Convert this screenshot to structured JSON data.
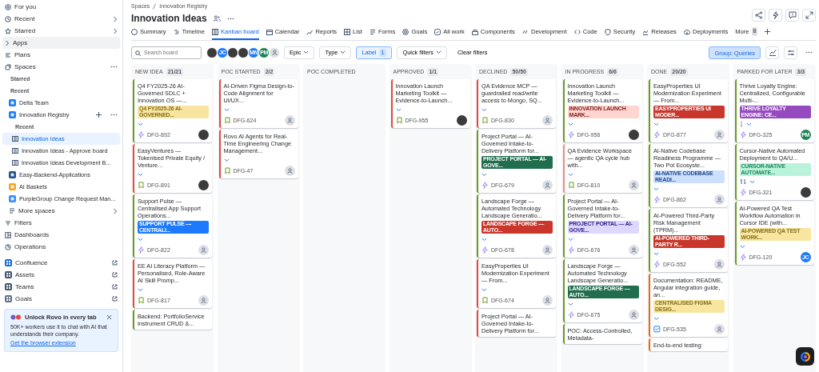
{
  "sidebar": {
    "items": [
      {
        "kind": "nav",
        "label": "For you",
        "submenu": false,
        "menu": false,
        "add": false,
        "external": false,
        "selected": false
      },
      {
        "kind": "nav",
        "label": "Recent",
        "submenu": true,
        "menu": false,
        "add": false,
        "external": false,
        "selected": false
      },
      {
        "kind": "nav",
        "label": "Starred",
        "submenu": true,
        "menu": false,
        "add": false,
        "external": false,
        "selected": false
      },
      {
        "kind": "expander",
        "label": "Apps",
        "submenu": false,
        "menu": false,
        "add": false,
        "external": false,
        "selected": false
      },
      {
        "kind": "nav",
        "label": "Plans",
        "submenu": false,
        "menu": false,
        "add": false,
        "external": false,
        "selected": false
      },
      {
        "kind": "nav",
        "label": "Spaces",
        "submenu": false,
        "menu": true,
        "add": false,
        "external": false,
        "selected": false
      },
      {
        "kind": "heading",
        "label": "Starred",
        "submenu": false,
        "menu": false,
        "add": false,
        "external": false,
        "selected": false
      },
      {
        "kind": "heading",
        "label": "Recent",
        "submenu": false,
        "menu": false,
        "add": false,
        "external": false,
        "selected": false
      },
      {
        "kind": "space",
        "label": "Delta Team",
        "color": "#1d7afc",
        "submenu": false,
        "menu": false,
        "add": false,
        "external": false,
        "selected": false
      },
      {
        "kind": "space",
        "label": "Innovation Registry",
        "color": "#1d7afc",
        "submenu": false,
        "menu": true,
        "add": true,
        "external": false,
        "selected": false
      },
      {
        "kind": "subheading",
        "label": "Recent",
        "submenu": false,
        "menu": false,
        "add": false,
        "external": false,
        "selected": false
      },
      {
        "kind": "board",
        "label": "Innovation Ideas",
        "submenu": false,
        "menu": false,
        "add": false,
        "external": false,
        "selected": true
      },
      {
        "kind": "board",
        "label": "Innovation Ideas - Approve board",
        "submenu": false,
        "menu": false,
        "add": false,
        "external": false,
        "selected": false
      },
      {
        "kind": "board",
        "label": "Innovation Ideas Development B...",
        "submenu": false,
        "menu": false,
        "add": false,
        "external": false,
        "selected": false
      },
      {
        "kind": "space",
        "label": "Easy-Backend-Applications",
        "color": "#1f4f8f",
        "submenu": false,
        "menu": false,
        "add": false,
        "external": false,
        "selected": false
      },
      {
        "kind": "space",
        "label": "AI Baskets",
        "color": "#f5a623",
        "submenu": false,
        "menu": false,
        "add": false,
        "external": false,
        "selected": false
      },
      {
        "kind": "space",
        "label": "PurpleGroup Change Request Man...",
        "color": "#388bff",
        "submenu": false,
        "menu": false,
        "add": false,
        "external": false,
        "selected": false
      },
      {
        "kind": "more",
        "label": "More spaces",
        "submenu": true,
        "menu": false,
        "add": false,
        "external": false,
        "selected": false
      },
      {
        "kind": "nav",
        "label": "Filters",
        "submenu": false,
        "menu": false,
        "add": false,
        "external": false,
        "selected": false
      },
      {
        "kind": "nav",
        "label": "Dashboards",
        "submenu": false,
        "menu": false,
        "add": false,
        "external": false,
        "selected": false
      },
      {
        "kind": "nav",
        "label": "Operations",
        "submenu": false,
        "menu": false,
        "add": false,
        "external": false,
        "selected": false
      },
      {
        "kind": "app",
        "label": "Confluence",
        "color": "#1868db",
        "submenu": false,
        "menu": false,
        "add": false,
        "external": true,
        "selected": false
      },
      {
        "kind": "app",
        "label": "Assets",
        "color": "#44546f",
        "submenu": false,
        "menu": false,
        "add": false,
        "external": true,
        "selected": false
      },
      {
        "kind": "app",
        "label": "Teams",
        "color": "#44546f",
        "submenu": false,
        "menu": false,
        "add": false,
        "external": true,
        "selected": false
      },
      {
        "kind": "app",
        "label": "Goals",
        "color": "#626f86",
        "submenu": false,
        "menu": false,
        "add": false,
        "external": true,
        "selected": false
      }
    ],
    "promo": {
      "title": "Unlock Rovo in every tab",
      "text": "50K+ workers use it to chat with AI that understands their company.",
      "link": "Get the browser extension"
    }
  },
  "header": {
    "breadcrumbs": [
      "Spaces",
      "Innovation Registry"
    ],
    "title": "Innovation Ideas",
    "tabs": [
      {
        "label": "Summary",
        "selected": false
      },
      {
        "label": "Timeline",
        "selected": false
      },
      {
        "label": "Kanban board",
        "selected": true
      },
      {
        "label": "Calendar",
        "selected": false
      },
      {
        "label": "Reports",
        "selected": false
      },
      {
        "label": "List",
        "selected": false
      },
      {
        "label": "Forms",
        "selected": false
      },
      {
        "label": "Goals",
        "selected": false
      },
      {
        "label": "All work",
        "selected": false
      },
      {
        "label": "Components",
        "selected": false
      },
      {
        "label": "Development",
        "selected": false
      },
      {
        "label": "Code",
        "selected": false
      },
      {
        "label": "Security",
        "selected": false
      },
      {
        "label": "Releases",
        "selected": false
      },
      {
        "label": "Deployments",
        "selected": false
      }
    ],
    "more_tabs": {
      "label": "More",
      "count": "8"
    }
  },
  "toolbar": {
    "search": {
      "placeholder": "Search board"
    },
    "avatars": [
      {
        "kind": "photo"
      },
      {
        "kind": "initials",
        "initials": "JC",
        "color": "#1d7afc"
      },
      {
        "kind": "photo"
      },
      {
        "kind": "photo"
      },
      {
        "kind": "initials",
        "initials": "MN",
        "color": "#1d7afc"
      },
      {
        "kind": "initials",
        "initials": "PM",
        "color": "#1f845a"
      },
      {
        "kind": "unassigned"
      }
    ],
    "filters": [
      {
        "label": "Epic",
        "kind": "dropdown",
        "active": false
      },
      {
        "label": "Type",
        "kind": "dropdown",
        "active": false
      },
      {
        "label": "Label",
        "kind": "count",
        "count": "1",
        "active": true
      },
      {
        "label": "Quick filters",
        "kind": "dropdown",
        "active": false
      },
      {
        "label": "Clear filters",
        "kind": "plain",
        "active": false
      }
    ],
    "group": "Group: Queries"
  },
  "columns": [
    {
      "name": "NEW IDEA",
      "count": "21/21",
      "cards": [
        {
          "title": "Q4 FY2025-26 AI-Governed SDLC + Innovation OS —...",
          "label": {
            "text": "Q4 FY2025-26 AI-GOVERNED...",
            "color": "#f8e6a0"
          },
          "kind": "epic",
          "key": "DFG-892",
          "color": "#6a9a23",
          "assignee": {
            "kind": "photo"
          }
        },
        {
          "title": "EasyVentures — Tokenised Private Equity / Venture...",
          "kind": "story",
          "key": "DFG-891",
          "color": "#e2483d",
          "assignee": {
            "kind": "photo"
          }
        },
        {
          "title": "Support Pulse — Centralised App Support Operations...",
          "label": {
            "text": "SUPPORT PULSE — CENTRALI...",
            "color": "#1d7afc"
          },
          "kind": "epic",
          "key": "DFG-822",
          "color": "#6a9a23",
          "assignee": {
            "kind": "unassigned"
          }
        },
        {
          "title": "EE AI Literacy Platform — Personalised, Role-Aware AI Skill Promp...",
          "kind": "story",
          "key": "DFG-817",
          "color": "#e2483d",
          "assignee": {
            "kind": "unassigned"
          }
        },
        {
          "title": "Backend: PortfolioService Instrument CRUD &...",
          "color": "#6a9a23"
        }
      ]
    },
    {
      "name": "POC STARTED",
      "count": "2/2",
      "cards": [
        {
          "title": "AI-Driven Figma Design-to-Code Alignment for UI/UX...",
          "kind": "story",
          "key": "DFG-624",
          "color": "#e2483d",
          "assignee": {
            "kind": "unassigned"
          }
        },
        {
          "title": "Rovo AI Agents for Real-Time Engineering Change Management...",
          "kind": "story",
          "key": "DFG-47",
          "color": "#e2483d",
          "assignee": {
            "kind": "unassigned"
          }
        }
      ]
    },
    {
      "name": "POC COMPLETED"
    },
    {
      "name": "APPROVED",
      "count": "1/1",
      "cards": [
        {
          "title": "Innovation Launch Marketing Toolkit — Evidence-to-Launch...",
          "kind": "story",
          "key": "DFG-955",
          "color": "#e2483d",
          "assignee": {
            "kind": "photo"
          }
        }
      ]
    },
    {
      "name": "DECLINED",
      "count": "50/50",
      "cards": [
        {
          "title": "QA Evidence MCP — guardrailed read/write access to Mongo, SQ...",
          "kind": "story",
          "key": "DFG-830",
          "color": "#e2483d",
          "assignee": {
            "kind": "unassigned"
          }
        },
        {
          "title": "Project Portal — AI-Governed Intake-to-Delivery Platform for...",
          "label": {
            "text": "PROJECT PORTAL — AI-GOVE...",
            "color": "#216e4e"
          },
          "kind": "epic",
          "key": "DFG-679",
          "color": "#6a9a23",
          "assignee": {
            "kind": "unassigned"
          }
        },
        {
          "title": "Landscape Forge — Automated Technology Landscape Generatio...",
          "label": {
            "text": "LANDSCAPE FORGE — AUTO...",
            "color": "#c9372c"
          },
          "kind": "epic",
          "key": "DFG-678",
          "color": "#6a9a23",
          "assignee": {
            "kind": "unassigned"
          }
        },
        {
          "title": "EasyProperties UI Modernization Experiment — From...",
          "kind": "story",
          "key": "DFG-674",
          "color": "#e2483d",
          "assignee": {
            "kind": "unassigned"
          }
        },
        {
          "title": "Project Portal — AI-Governed Intake-to-Delivery Platform for...",
          "color": "#e2483d"
        }
      ]
    },
    {
      "name": "IN PROGRESS",
      "count": "6/6",
      "cards": [
        {
          "title": "Innovation Launch Marketing Toolkit — Evidence-to-Launch...",
          "label": {
            "text": "INNOVATION LAUNCH MARK...",
            "color": "#ffd5d2"
          },
          "kind": "epic",
          "key": "DFG-956",
          "color": "#6a9a23",
          "assignee": {
            "kind": "photo"
          }
        },
        {
          "title": "QA Evidence Workspace — agentic QA cycle hub with...",
          "kind": "story",
          "key": "DFG-810",
          "color": "#f28b82",
          "assignee": {
            "kind": "unassigned"
          }
        },
        {
          "title": "Project Portal — AI-Governed Intake-to-Delivery Platform for...",
          "label": {
            "text": "PROJECT PORTAL — AI-GOVE...",
            "color": "#dfd8fd"
          },
          "kind": "epic",
          "key": "DFG-676",
          "color": "#6a9a23",
          "assignee": {
            "kind": "unassigned"
          }
        },
        {
          "title": "Landscape Forge — Automated Technology Landscape Generatio...",
          "label": {
            "text": "LANDSCAPE FORGE — AUTO...",
            "color": "#216e4e"
          },
          "kind": "epic",
          "key": "DFG-675",
          "color": "#6a9a23",
          "assignee": {
            "kind": "unassigned"
          }
        },
        {
          "title": "POC: Access-Controlled, Metadata-",
          "color": "#6a9a23"
        }
      ]
    },
    {
      "name": "DONE",
      "count": "20/20",
      "cards": [
        {
          "title": "EasyProperties UI Modernization Experiment — From...",
          "label": {
            "text": "EASYPROPERTIES UI MODER...",
            "color": "#c9372c"
          },
          "kind": "epic",
          "key": "DFG-877",
          "color": "#6a9a23",
          "assignee": {
            "kind": "unassigned"
          }
        },
        {
          "title": "AI-Native Codebase Readiness Programme — Two Pot Ecosyste...",
          "label": {
            "text": "AI-NATIVE CODEBASE READI...",
            "color": "#cce0ff"
          },
          "kind": "epic",
          "key": "DFG-862",
          "color": "#6a9a23",
          "assignee": {
            "kind": "unassigned"
          }
        },
        {
          "title": "AI-Powered Third-Party Risk Management (TPRM)...",
          "label": {
            "text": "AI-POWERED THIRD-PARTY R...",
            "color": "#c9372c"
          },
          "kind": "epic",
          "key": "DFG-552",
          "color": "#6a9a23",
          "assignee": {
            "kind": "unassigned"
          }
        },
        {
          "title": "Documentation: README, Angular integration guide, an...",
          "label": {
            "text": "CENTRALISED FIGMA DESIG...",
            "color": "#f8e6a0"
          },
          "kind": "task",
          "key": "DFG-535",
          "color": "#e56910",
          "assignee": {
            "kind": "unassigned"
          }
        },
        {
          "title": "End-to-end testing:",
          "color": "#e56910"
        }
      ]
    },
    {
      "name": "PARKED FOR LATER",
      "count": "3/3",
      "cards": [
        {
          "title": "Thrive Loyalty Engine: Centralized, Configurable Multi-...",
          "label": {
            "text": "THRIVE LOYALTY ENGINE: CE...",
            "color": "#964ac0"
          },
          "indicator": {
            "kind": "dots"
          },
          "kind": "epic",
          "key": "DFG-325",
          "color": "#6a9a23",
          "assignee": {
            "kind": "initials",
            "initials": "PM",
            "color": "#1f845a"
          }
        },
        {
          "title": "Cursor-Native Automated Deployment to QA/U...",
          "label": {
            "text": "CURSOR-NATIVE AUTOMATE...",
            "color": "#baf3db"
          },
          "indicator": {
            "kind": "arrows"
          },
          "kind": "epic",
          "key": "DFG-321",
          "color": "#6a9a23",
          "assignee": {
            "kind": "photo"
          }
        },
        {
          "title": "AI-Powered QA Test Workflow Automation in Cursor IDE (with...",
          "label": {
            "text": "AI-POWERED QA TEST WORK...",
            "color": "#f8e6a0"
          },
          "kind": "epic",
          "key": "DFG-120",
          "color": "#6a9a23",
          "assignee": {
            "kind": "initials",
            "initials": "JC",
            "color": "#1d7afc"
          }
        }
      ]
    }
  ]
}
